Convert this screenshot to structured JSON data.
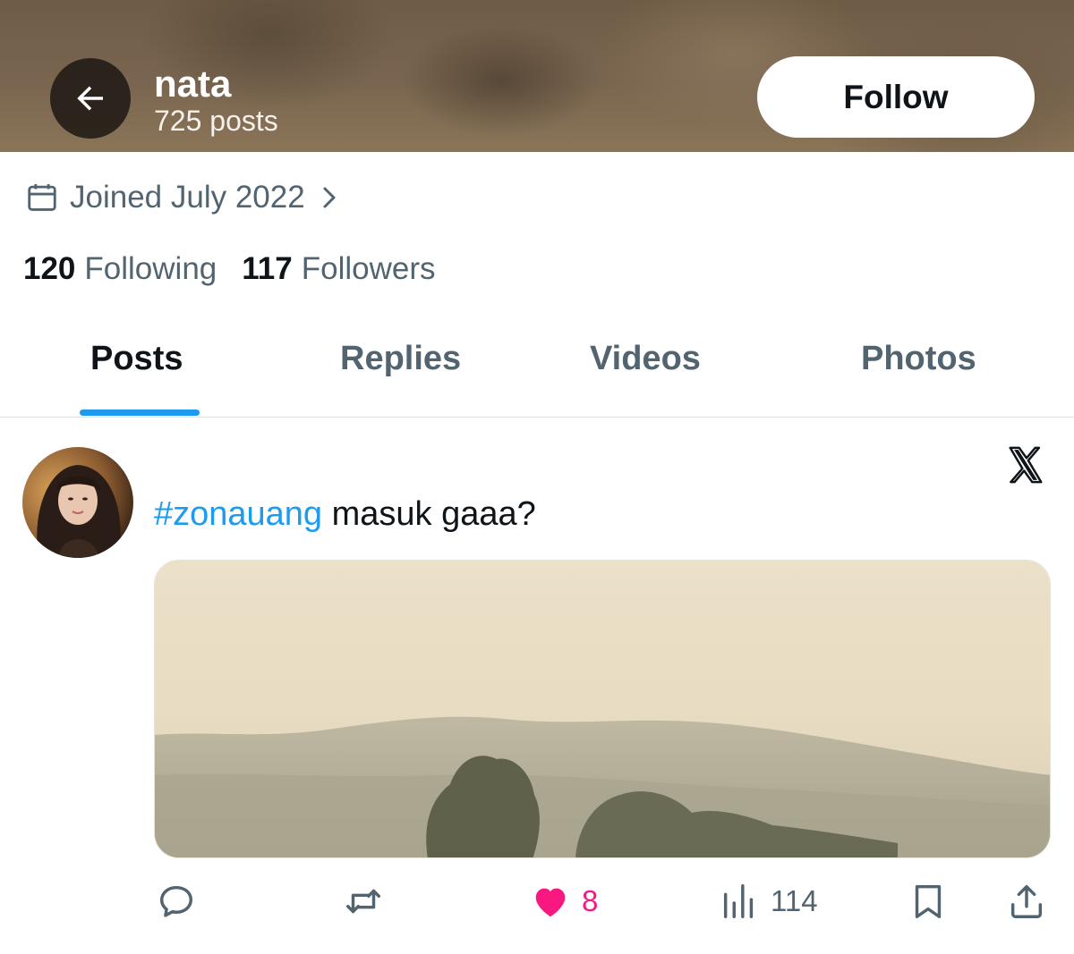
{
  "header": {
    "name": "nata",
    "post_count": "725 posts",
    "follow_label": "Follow",
    "back_icon": "arrow-left-icon"
  },
  "profile": {
    "joined": "Joined July 2022",
    "following_count": "120",
    "following_label": "Following",
    "followers_count": "117",
    "followers_label": "Followers"
  },
  "tabs": [
    {
      "label": "Posts",
      "active": true
    },
    {
      "label": "Replies",
      "active": false
    },
    {
      "label": "Videos",
      "active": false
    },
    {
      "label": "Photos",
      "active": false
    }
  ],
  "post": {
    "hashtag": "#zonauang",
    "text": " masuk gaaa?",
    "actions": {
      "reply": {
        "icon": "reply-icon"
      },
      "repost": {
        "icon": "repost-icon"
      },
      "like": {
        "icon": "heart-icon",
        "count": "8",
        "liked": true
      },
      "views": {
        "icon": "views-icon",
        "count": "114"
      },
      "bookmark": {
        "icon": "bookmark-icon"
      },
      "share": {
        "icon": "share-icon"
      }
    }
  },
  "colors": {
    "accent": "#1d9bf0",
    "like": "#f91880",
    "secondary_text": "#536471",
    "primary_text": "#0f1419"
  }
}
